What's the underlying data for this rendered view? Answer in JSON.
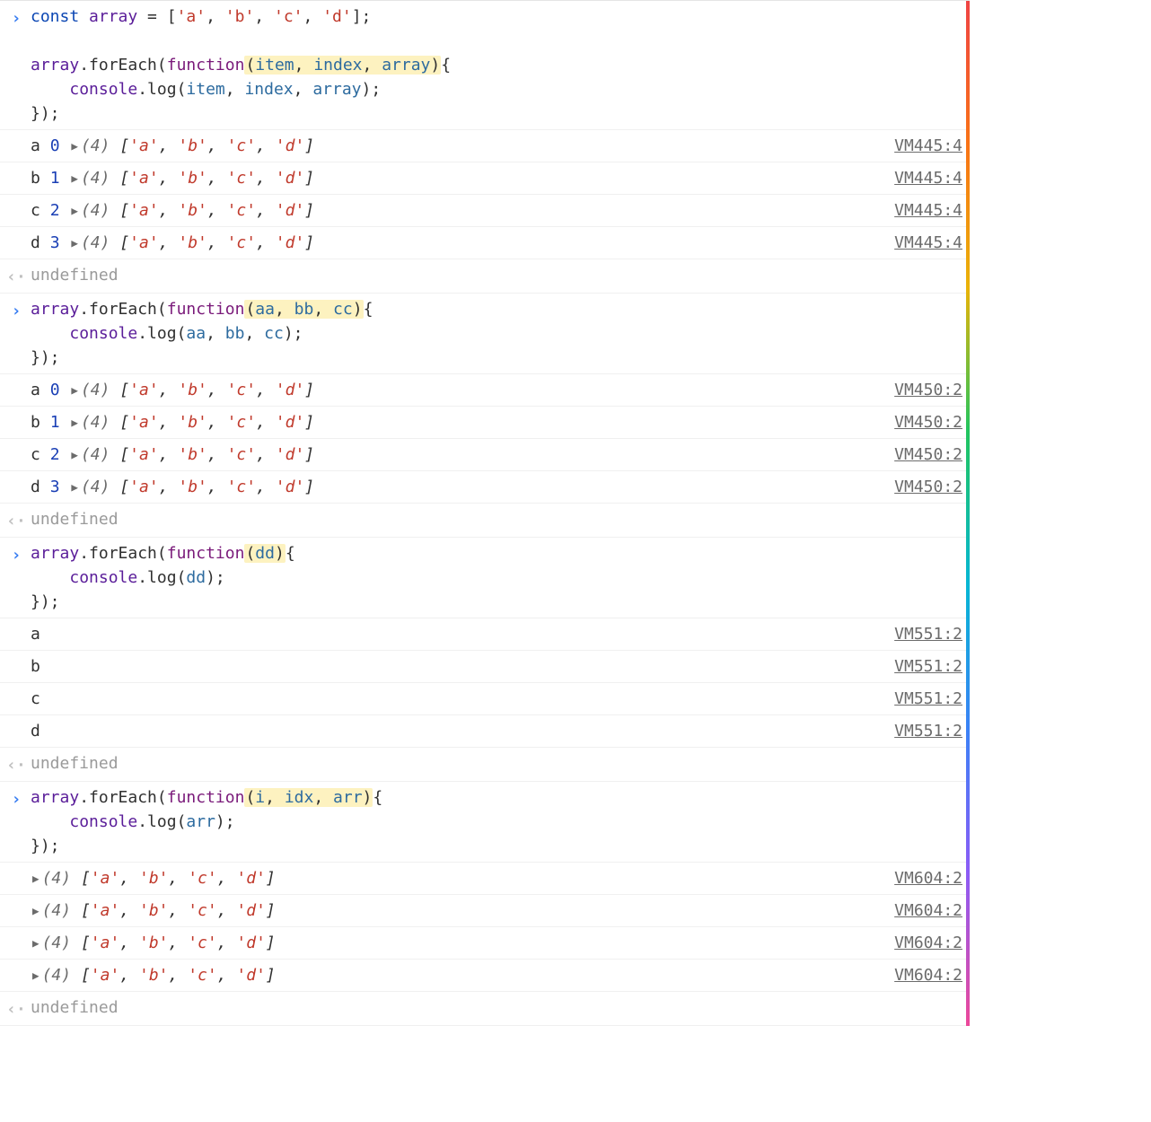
{
  "glyphs": {
    "input": "›",
    "return": "‹·",
    "expand": "▶"
  },
  "code1": {
    "l1_const": "const",
    "l1_var": "array",
    "l1_eq": " = [",
    "l1_s": "'a'",
    "l1_c1": ", ",
    "l1_s2": "'b'",
    "l1_c2": ", ",
    "l1_s3": "'c'",
    "l1_c3": ", ",
    "l1_s4": "'d'",
    "l1_end": "];",
    "l3_arr": "array",
    "l3_m": ".forEach(",
    "l3_fn": "function",
    "l3_open": "(",
    "l3_p1": "item",
    "l3_pc1": ", ",
    "l3_p2": "index",
    "l3_pc2": ", ",
    "l3_p3": "array",
    "l3_close": ")",
    "l3_brace": "{",
    "l4_indent": "    ",
    "l4_console": "console",
    "l4_m": ".log(",
    "l4_a1": "item",
    "l4_c1": ", ",
    "l4_a2": "index",
    "l4_c2": ", ",
    "l4_a3": "array",
    "l4_close": ");",
    "l5": "});"
  },
  "arrOut": {
    "len": "(4)",
    "open": "[",
    "s1": "'a'",
    "c1": ", ",
    "s2": "'b'",
    "c2": ", ",
    "s3": "'c'",
    "c3": ", ",
    "s4": "'d'",
    "close": "]"
  },
  "out1": [
    {
      "letter": "a",
      "idx": "0",
      "src": "VM445:4"
    },
    {
      "letter": "b",
      "idx": "1",
      "src": "VM445:4"
    },
    {
      "letter": "c",
      "idx": "2",
      "src": "VM445:4"
    },
    {
      "letter": "d",
      "idx": "3",
      "src": "VM445:4"
    }
  ],
  "ret1": "undefined",
  "code2": {
    "l1_arr": "array",
    "l1_m": ".forEach(",
    "l1_fn": "function",
    "l1_open": "(",
    "l1_p1": "aa",
    "l1_pc1": ", ",
    "l1_p2": "bb",
    "l1_pc2": ", ",
    "l1_p3": "cc",
    "l1_close": ")",
    "l1_brace": "{",
    "l2_indent": "    ",
    "l2_console": "console",
    "l2_m": ".log(",
    "l2_a1": "aa",
    "l2_c1": ", ",
    "l2_a2": "bb",
    "l2_c2": ", ",
    "l2_a3": "cc",
    "l2_close": ");",
    "l3": "});"
  },
  "out2": [
    {
      "letter": "a",
      "idx": "0",
      "src": "VM450:2"
    },
    {
      "letter": "b",
      "idx": "1",
      "src": "VM450:2"
    },
    {
      "letter": "c",
      "idx": "2",
      "src": "VM450:2"
    },
    {
      "letter": "d",
      "idx": "3",
      "src": "VM450:2"
    }
  ],
  "ret2": "undefined",
  "code3": {
    "l1_arr": "array",
    "l1_m": ".forEach(",
    "l1_fn": "function",
    "l1_open": "(",
    "l1_p1": "dd",
    "l1_close": ")",
    "l1_brace": "{",
    "l2_indent": "    ",
    "l2_console": "console",
    "l2_m": ".log(",
    "l2_a1": "dd",
    "l2_close": ");",
    "l3": "});"
  },
  "out3": [
    {
      "letter": "a",
      "src": "VM551:2"
    },
    {
      "letter": "b",
      "src": "VM551:2"
    },
    {
      "letter": "c",
      "src": "VM551:2"
    },
    {
      "letter": "d",
      "src": "VM551:2"
    }
  ],
  "ret3": "undefined",
  "code4": {
    "l1_arr": "array",
    "l1_m": ".forEach(",
    "l1_fn": "function",
    "l1_open": "(",
    "l1_p1": "i",
    "l1_pc1": ", ",
    "l1_p2": "idx",
    "l1_pc2": ", ",
    "l1_p3": "arr",
    "l1_close": ")",
    "l1_brace": "{",
    "l2_indent": "    ",
    "l2_console": "console",
    "l2_m": ".log(",
    "l2_a1": "arr",
    "l2_close": ");",
    "l3": "});"
  },
  "out4": [
    {
      "src": "VM604:2"
    },
    {
      "src": "VM604:2"
    },
    {
      "src": "VM604:2"
    },
    {
      "src": "VM604:2"
    }
  ],
  "ret4": "undefined"
}
